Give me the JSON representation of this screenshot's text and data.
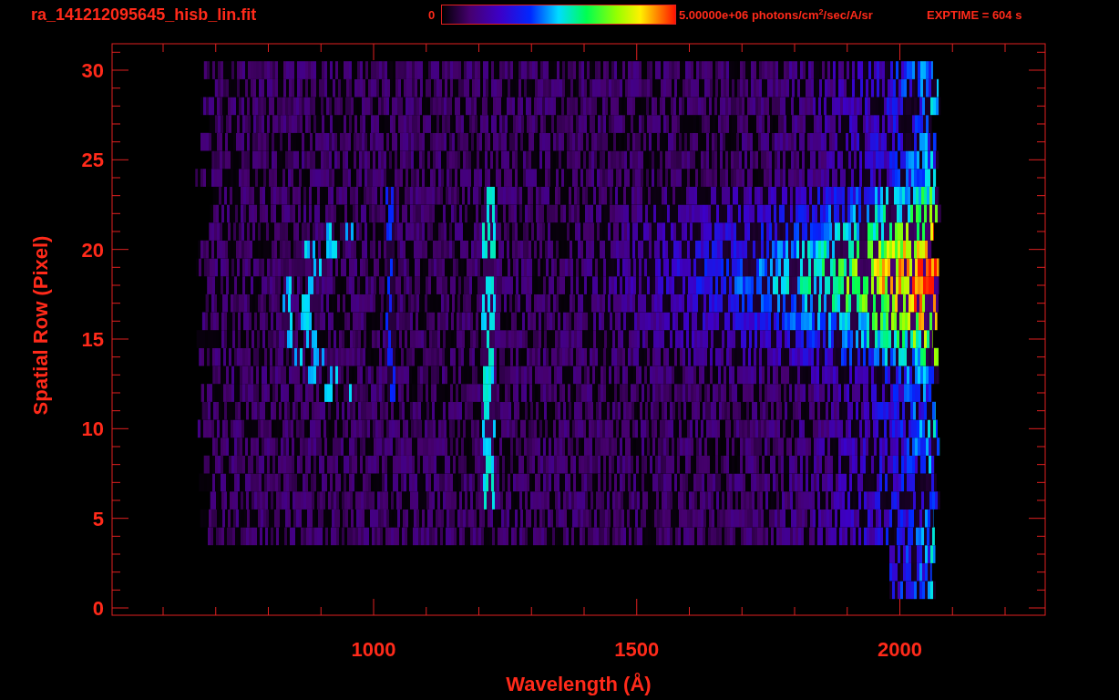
{
  "title": "ra_141212095645_hisb_lin.fit",
  "colorbar": {
    "min_label": "0",
    "max_label": "5.00000e+06 photons/cm$^{2}$/sec/A/sr"
  },
  "exposure": "EXPTIME = 604 s",
  "plot": {
    "ylabel": "Spatial Row (Pixel)",
    "xlabel": "Wavelength (Å)",
    "y_ticks": [
      "30",
      "25",
      "20",
      "15",
      "10",
      "5",
      "0"
    ],
    "x_ticks": [
      "1000",
      "1500",
      "2000"
    ]
  }
}
